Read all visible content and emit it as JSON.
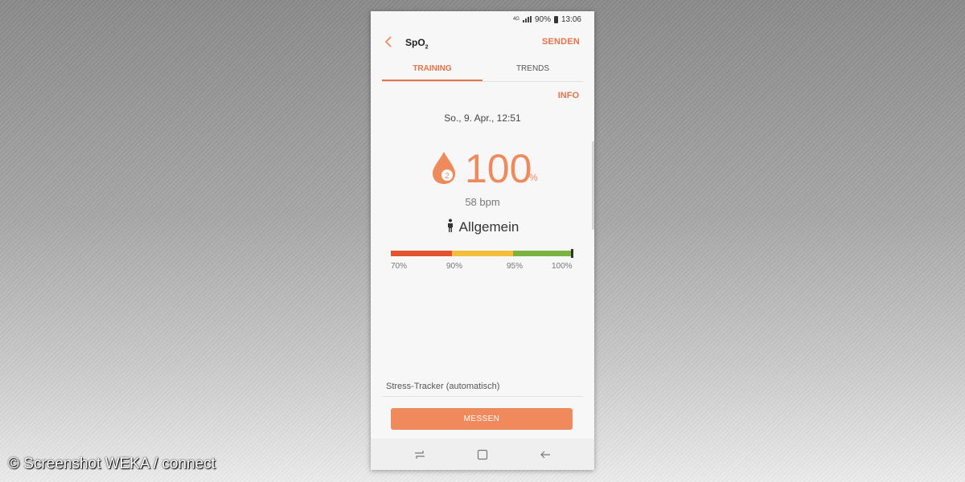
{
  "status_bar": {
    "network": "4G",
    "battery": "90%",
    "time": "13:06"
  },
  "app_bar": {
    "title": "SpO",
    "title_sub": "2",
    "send_label": "SENDEN"
  },
  "tabs": [
    {
      "label": "TRAINING",
      "active": true
    },
    {
      "label": "TRENDS",
      "active": false
    }
  ],
  "info_label": "INFO",
  "measurement": {
    "date": "So., 9. Apr., 12:51",
    "icon_number": "2",
    "value": "100",
    "unit": "%",
    "pulse": "58 bpm",
    "category": "Allgemein"
  },
  "scale": {
    "ticks": [
      "70%",
      "90%",
      "95%",
      "100%"
    ],
    "marker_value_percent": 100,
    "colors": {
      "low": "#e2532e",
      "medium": "#f2be3b",
      "high": "#7ab33f"
    }
  },
  "stress_tracker_label": "Stress-Tracker (automatisch)",
  "measure_button_label": "MESSEN",
  "accent_color": "#e8724a",
  "nav_icons": [
    "recent-apps-icon",
    "home-icon",
    "back-icon"
  ],
  "copyright": "© Screenshot WEKA / connect"
}
